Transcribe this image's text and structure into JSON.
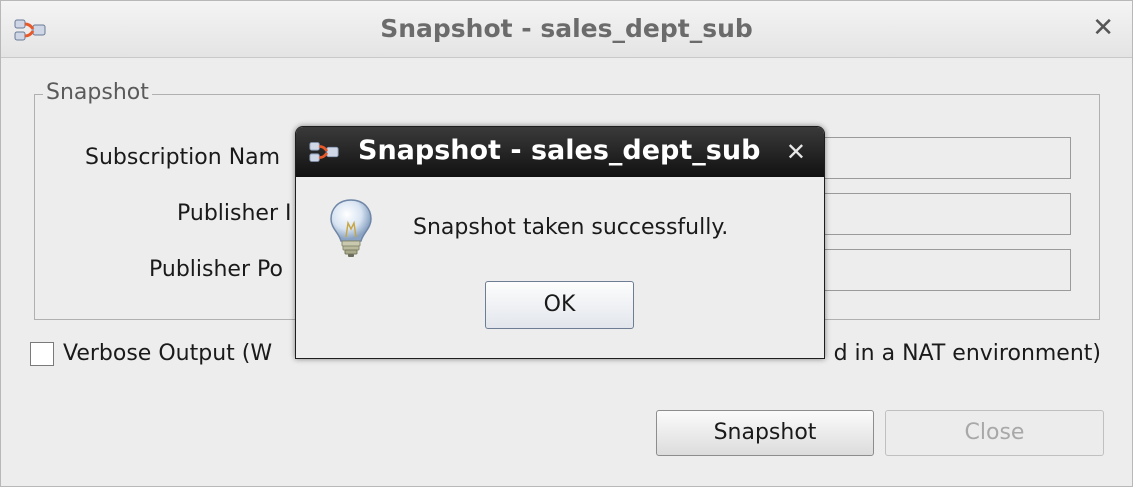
{
  "main_window": {
    "title": "Snapshot - sales_dept_sub",
    "group_title": "Snapshot",
    "fields": [
      {
        "label": "Subscription Nam",
        "value": ""
      },
      {
        "label": "Publisher I",
        "value": ""
      },
      {
        "label": "Publisher Po",
        "value": ""
      }
    ],
    "verbose_label": "Verbose Output  (W",
    "verbose_tail": "d in a NAT environment)",
    "verbose_checked": false,
    "snapshot_button": "Snapshot",
    "close_button": "Close"
  },
  "dialog": {
    "title": "Snapshot - sales_dept_sub",
    "message": "Snapshot taken successfully.",
    "ok_button": "OK"
  },
  "icons": {
    "app": "app-plug-icon",
    "info": "lightbulb-icon",
    "close": "close-icon"
  },
  "colors": {
    "dialog_titlebar": "#1c1c1c",
    "window_bg": "#ededed",
    "icon_accent": "#e8592a"
  }
}
